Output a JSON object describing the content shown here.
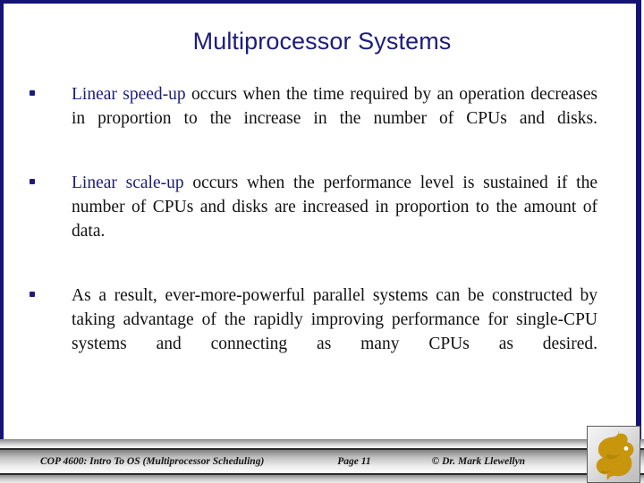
{
  "slide": {
    "title": "Multiprocessor Systems",
    "title_color": "#1c1c7c",
    "accent_color": "#141478",
    "bullets": [
      {
        "lead": "Linear speed-up",
        "rest": " occurs when the time required by an operation decreases in proportion to the increase in the number of CPUs and disks."
      },
      {
        "lead": "Linear scale-up",
        "rest": " occurs when the performance level is sustained if the number of CPUs and disks are increased in proportion to the amount of data."
      },
      {
        "lead": "",
        "rest": "As a result, ever-more-powerful parallel systems can be constructed by taking advantage of the rapidly improving performance for single-CPU systems and connecting as many CPUs as desired."
      }
    ]
  },
  "footer": {
    "course": "COP 4600: Intro To OS  (Multiprocessor Scheduling)",
    "page": "Page 11",
    "credit": "© Dr. Mark Llewellyn",
    "logo_icon": "pegasus-logo-icon",
    "logo_color": "#c8960c"
  }
}
